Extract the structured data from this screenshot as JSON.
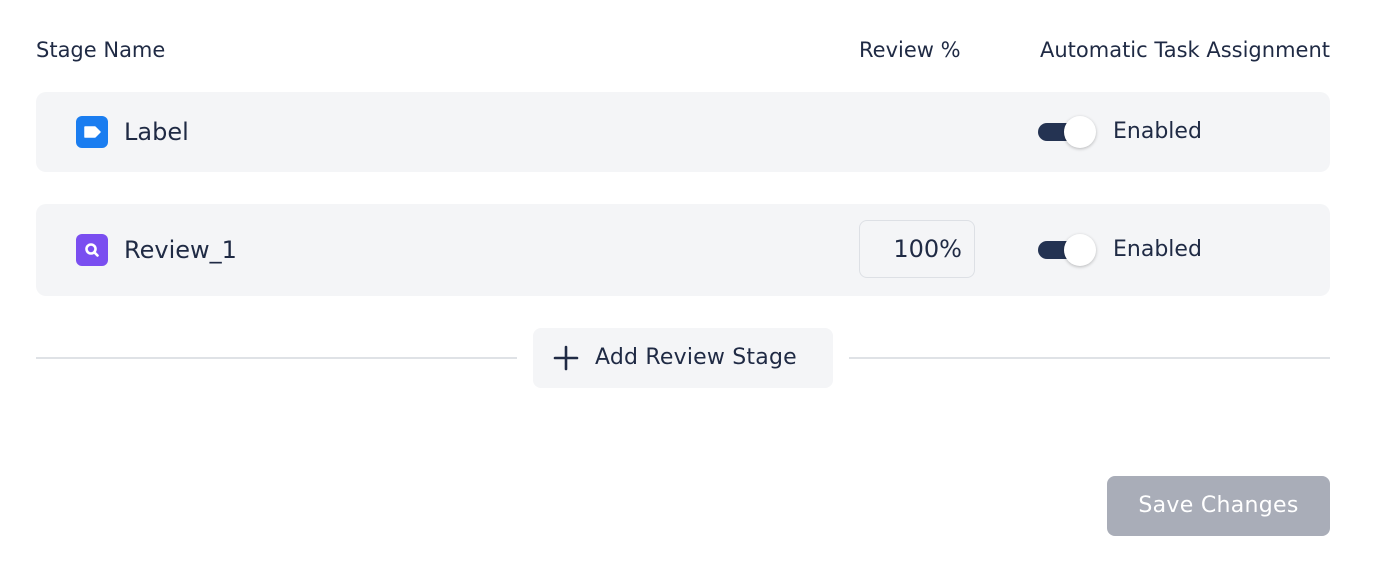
{
  "header": {
    "stage_name": "Stage Name",
    "review_pct": "Review %",
    "auto_assignment": "Automatic Task Assignment"
  },
  "stages": [
    {
      "name": "Label",
      "icon": "label-tag-icon",
      "icon_color": "#1a7df0",
      "review_pct": null,
      "auto_assignment_enabled": true,
      "auto_assignment_label": "Enabled"
    },
    {
      "name": "Review_1",
      "icon": "search-icon",
      "icon_color": "#7a4ef0",
      "review_pct": "100%",
      "auto_assignment_enabled": true,
      "auto_assignment_label": "Enabled"
    }
  ],
  "actions": {
    "add_review_stage": "Add Review Stage",
    "save_changes": "Save Changes"
  },
  "colors": {
    "toggle_on": "#243352",
    "save_disabled": "#a9adb8",
    "row_bg": "#f4f5f7"
  }
}
